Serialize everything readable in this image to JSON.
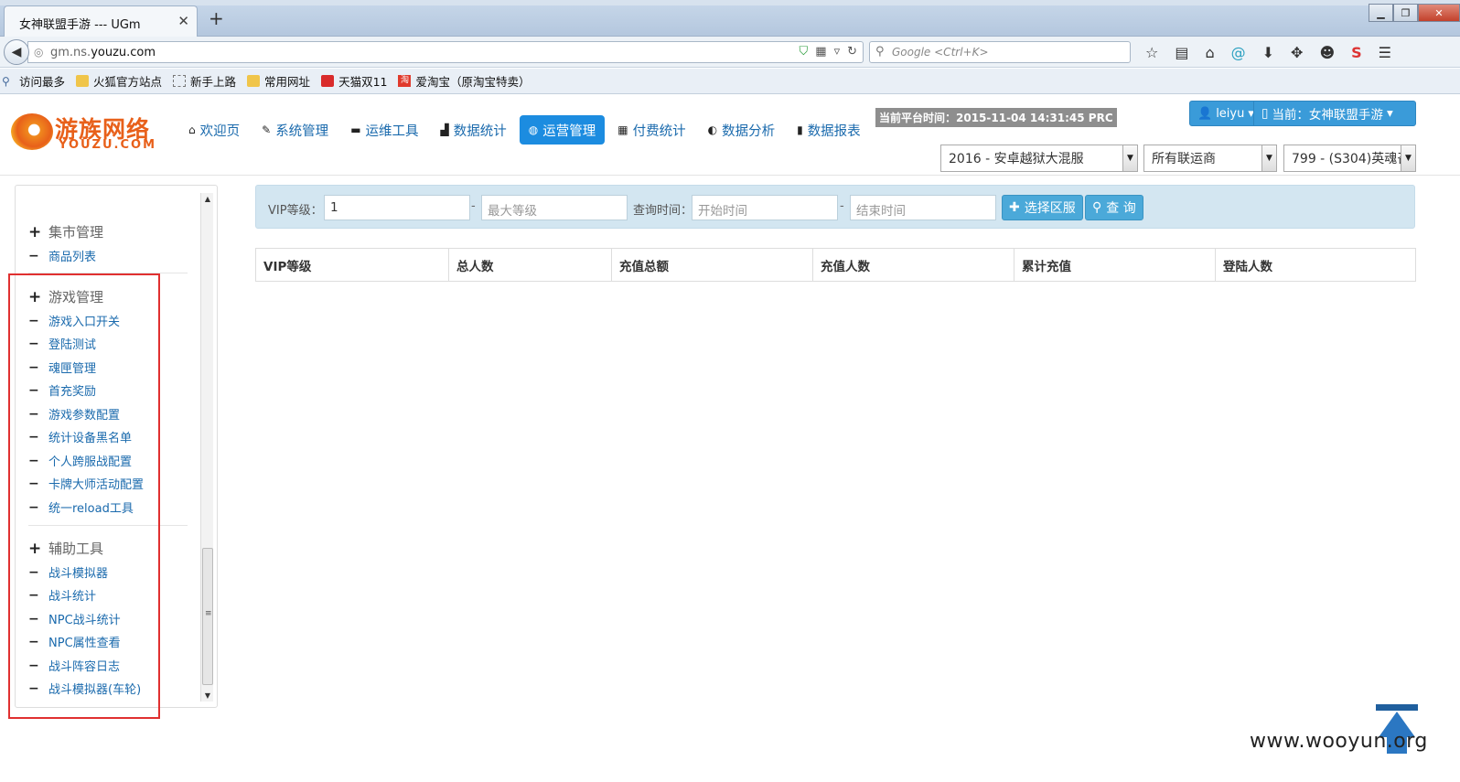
{
  "browser": {
    "tab_title": "女神联盟手游 --- UGm",
    "url_prefix": "gm.ns.",
    "url_domain": "youzu.com",
    "search_placeholder": "Google <Ctrl+K>",
    "bookmarks": [
      {
        "label": "访问最多"
      },
      {
        "label": "火狐官方站点"
      },
      {
        "label": "新手上路"
      },
      {
        "label": "常用网址"
      },
      {
        "label": "天猫双11"
      },
      {
        "label": "爱淘宝（原淘宝特卖）"
      }
    ]
  },
  "header": {
    "logo_cn": "游族网络",
    "logo_en": "YOUZU.COM",
    "nav": [
      {
        "label": "欢迎页",
        "icon": "home-icon"
      },
      {
        "label": "系统管理",
        "icon": "wrench-icon"
      },
      {
        "label": "运维工具",
        "icon": "hdd-icon"
      },
      {
        "label": "数据统计",
        "icon": "signal-icon"
      },
      {
        "label": "运营管理",
        "icon": "globe-icon",
        "active": true
      },
      {
        "label": "付费统计",
        "icon": "grid-icon"
      },
      {
        "label": "数据分析",
        "icon": "adjust-icon"
      },
      {
        "label": "数据报表",
        "icon": "book-icon"
      }
    ],
    "platform_time": "当前平台时间：2015-11-04 14:31:45 PRC",
    "user": "leiyu",
    "current": "当前：女神联盟手游",
    "selects": [
      "2016 - 安卓越狱大混服",
      "所有联运商",
      "799 - (S304)英魂召"
    ]
  },
  "sidebar": {
    "groups": [
      {
        "title": "集市管理",
        "items": [
          "商品列表"
        ]
      },
      {
        "title": "游戏管理",
        "items": [
          "游戏入口开关",
          "登陆测试",
          "魂匣管理",
          "首充奖励",
          "游戏参数配置",
          "统计设备黑名单",
          "个人跨服战配置",
          "卡牌大师活动配置",
          "统一reload工具"
        ]
      },
      {
        "title": "辅助工具",
        "items": [
          "战斗模拟器",
          "战斗统计",
          "NPC战斗统计",
          "NPC属性查看",
          "战斗阵容日志",
          "战斗模拟器(车轮)"
        ]
      }
    ]
  },
  "filter": {
    "vip_label": "VIP等级：",
    "vip_value": "1",
    "max_level_placeholder": "最大等级",
    "query_time_label": "查询时间：",
    "start_placeholder": "开始时间",
    "end_placeholder": "结束时间",
    "dash": "-",
    "select_server_button": "选择区服",
    "query_button": "查 询"
  },
  "table": {
    "headers": [
      "VIP等级",
      "总人数",
      "充值总额",
      "充值人数",
      "累计充值",
      "登陆人数"
    ]
  },
  "watermark": "www.wooyun.org",
  "colors": {
    "accent": "#1c8ce0",
    "brand": "#e8601a",
    "highlight_box": "#e03030",
    "filter_bg": "#d3e6f1"
  }
}
